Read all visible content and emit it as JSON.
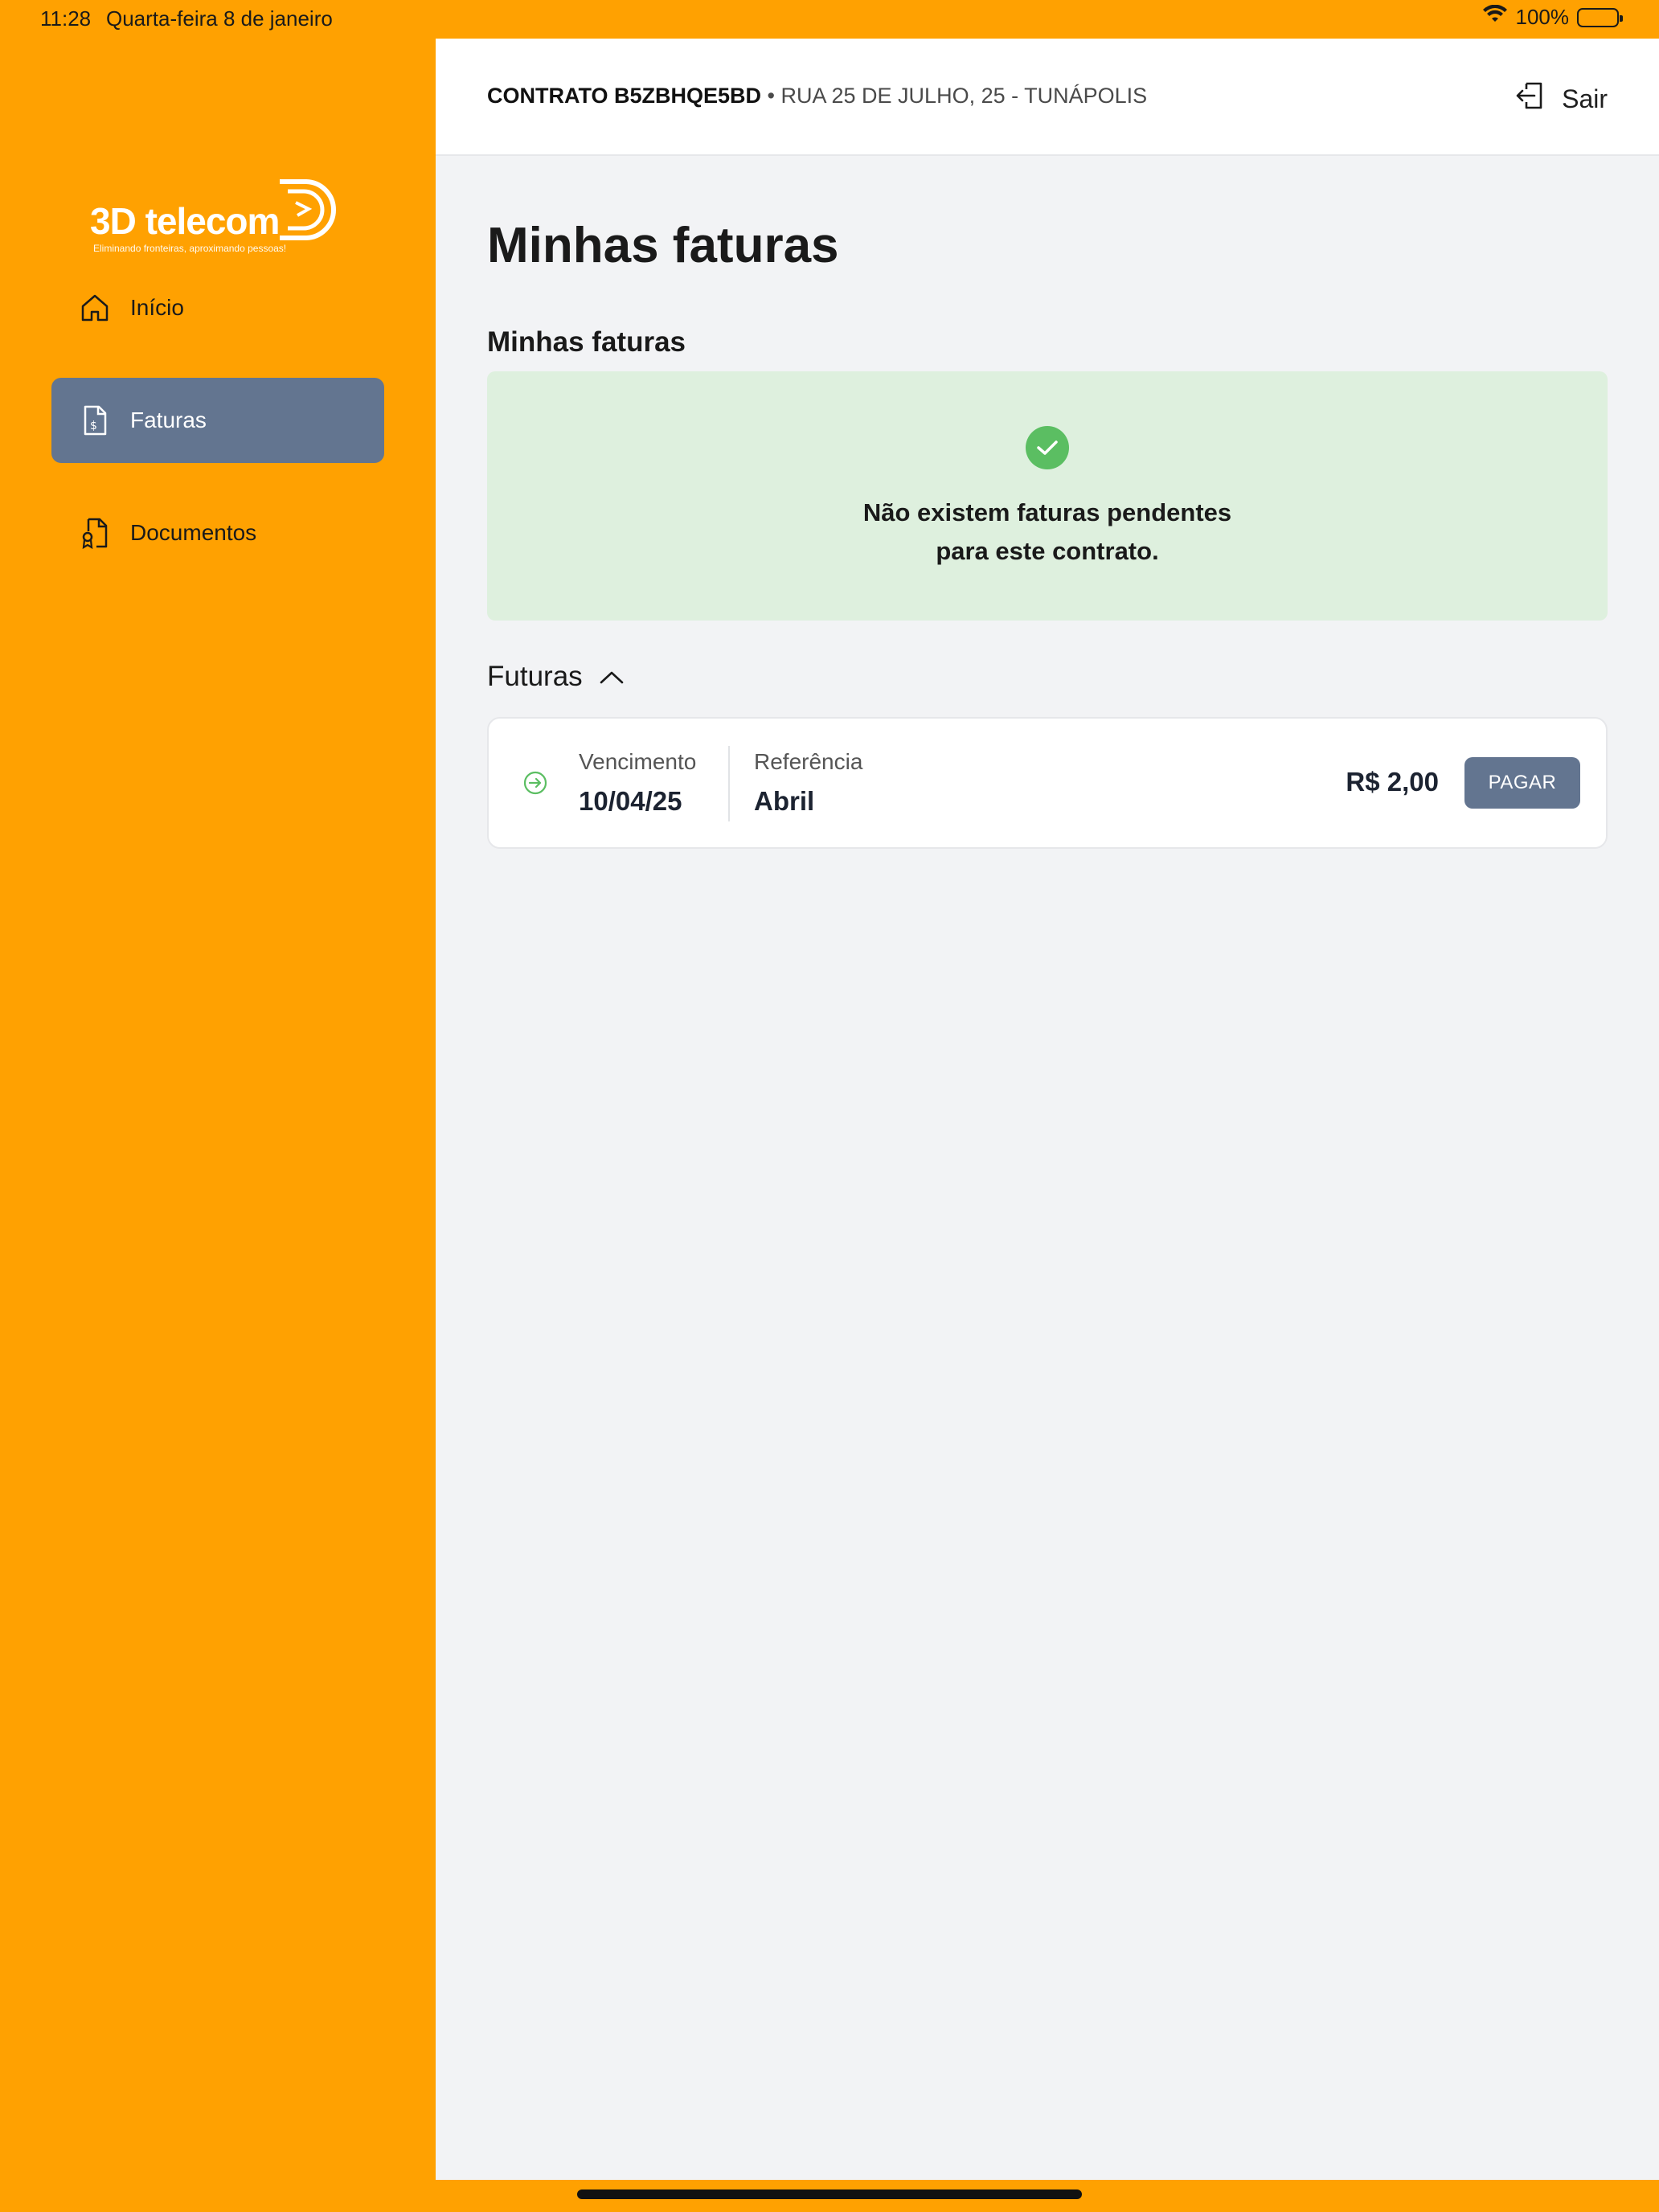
{
  "status_bar": {
    "time": "11:28",
    "date": "Quarta-feira 8 de janeiro",
    "battery": "100%"
  },
  "sidebar": {
    "logo": {
      "brand": "3D telecom",
      "tagline": "Eliminando fronteiras, aproximando pessoas!"
    },
    "items": [
      {
        "label": "Início",
        "icon": "home-icon",
        "active": false
      },
      {
        "label": "Faturas",
        "icon": "invoice-icon",
        "active": true
      },
      {
        "label": "Documentos",
        "icon": "document-icon",
        "active": false
      }
    ]
  },
  "header": {
    "contract_label": "CONTRATO B5ZBHQE5BD",
    "separator": " • ",
    "address": "RUA 25 DE JULHO, 25 - TUNÁPOLIS",
    "logout_label": "Sair"
  },
  "main": {
    "page_title": "Minhas faturas",
    "section_title": "Minhas faturas",
    "empty_message_line1": "Não existem faturas pendentes",
    "empty_message_line2": "para este contrato.",
    "futuras_label": "Futuras",
    "invoices": [
      {
        "due_label": "Vencimento",
        "due_date": "10/04/25",
        "ref_label": "Referência",
        "ref_value": "Abril",
        "amount": "R$ 2,00",
        "pay_label": "PAGAR"
      }
    ]
  },
  "colors": {
    "brand_orange": "#FFA101",
    "active_nav": "#637590",
    "success_bg": "#DEF0DE",
    "success_icon": "#5BBE62"
  }
}
